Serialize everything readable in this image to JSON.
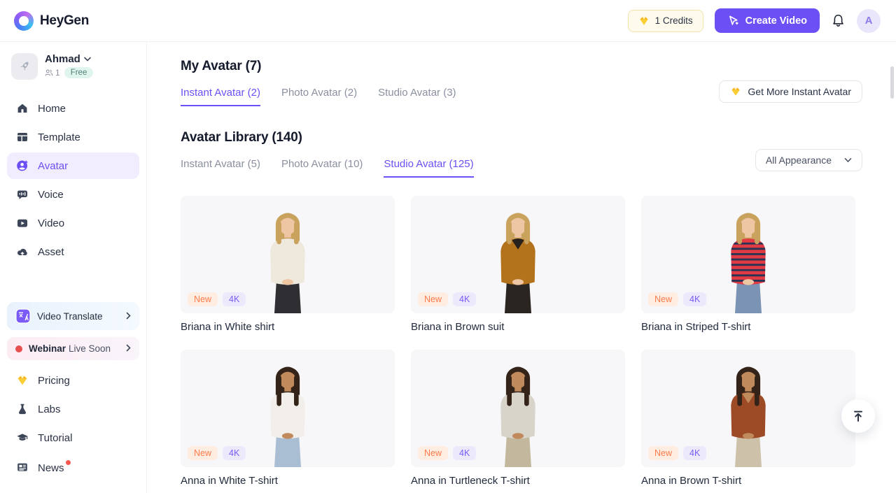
{
  "topbar": {
    "brand": "HeyGen",
    "credits_label": "1 Credits",
    "create_video_label": "Create Video",
    "profile_initial": "A"
  },
  "sidebar": {
    "workspace": {
      "name": "Ahmad",
      "member_count": "1",
      "plan_badge": "Free"
    },
    "items": [
      {
        "label": "Home"
      },
      {
        "label": "Template"
      },
      {
        "label": "Avatar",
        "active": true
      },
      {
        "label": "Voice"
      },
      {
        "label": "Video"
      },
      {
        "label": "Asset"
      }
    ],
    "promos": {
      "video_translate": {
        "label": "Video Translate"
      },
      "webinar": {
        "label_bold": "Webinar",
        "label_rest": "Live Soon"
      }
    },
    "footer_items": [
      {
        "label": "Pricing"
      },
      {
        "label": "Labs"
      },
      {
        "label": "Tutorial"
      },
      {
        "label": "News",
        "has_notification": true
      }
    ]
  },
  "main": {
    "my_avatar": {
      "title": "My Avatar (7)",
      "tabs": [
        {
          "label": "Instant Avatar (2)",
          "active": true
        },
        {
          "label": "Photo Avatar (2)",
          "active": false
        },
        {
          "label": "Studio Avatar (3)",
          "active": false
        }
      ],
      "get_more_label": "Get More Instant Avatar"
    },
    "library": {
      "title": "Avatar Library (140)",
      "tabs": [
        {
          "label": "Instant Avatar (5)",
          "active": false
        },
        {
          "label": "Photo Avatar (10)",
          "active": false
        },
        {
          "label": "Studio Avatar (125)",
          "active": true
        }
      ],
      "filter_label": "All Appearance"
    },
    "cards": [
      {
        "name": "Briana in White shirt",
        "badges": {
          "new": "New",
          "res": "4K"
        },
        "figure": {
          "hair": "#c9a25e",
          "skin": "#efc6a3",
          "top": "#efe9dd",
          "bottom": "#2e2e33",
          "hair_len": 56,
          "strand_len": 34
        }
      },
      {
        "name": "Briana in Brown suit",
        "badges": {
          "new": "New",
          "res": "4K"
        },
        "figure": {
          "hair": "#c9a25e",
          "skin": "#efc6a3",
          "top": "#b3731d",
          "bottom": "#2b2522",
          "under": "#26211d",
          "hair_len": 56,
          "strand_len": 34
        }
      },
      {
        "name": "Briana in Striped T-shirt",
        "badges": {
          "new": "New",
          "res": "4K"
        },
        "figure": {
          "hair": "#c9a25e",
          "skin": "#efc6a3",
          "top": "#e03a44",
          "stripe": "#2a3353",
          "bottom": "#7b93b5",
          "hair_len": 56,
          "strand_len": 34
        }
      },
      {
        "name": "Anna in White T-shirt",
        "badges": {
          "new": "New",
          "res": "4K"
        },
        "figure": {
          "hair": "#342318",
          "skin": "#c08a5c",
          "top": "#f2efea",
          "bottom": "#a9bdd3",
          "hair_len": 76,
          "strand_len": 46
        }
      },
      {
        "name": "Anna in Turtleneck T-shirt",
        "badges": {
          "new": "New",
          "res": "4K"
        },
        "figure": {
          "hair": "#342318",
          "skin": "#c08a5c",
          "top": "#d9d4ca",
          "bottom": "#c3b79e",
          "hair_len": 76,
          "strand_len": 46
        }
      },
      {
        "name": "Anna in Brown T-shirt",
        "badges": {
          "new": "New",
          "res": "4K"
        },
        "figure": {
          "hair": "#342318",
          "skin": "#c08a5c",
          "top": "#9d4a26",
          "under": "#c08a5c",
          "bottom": "#cdc1aa",
          "hair_len": 76,
          "strand_len": 46
        }
      }
    ]
  },
  "colors": {
    "accent_purple": "#6d4ff6",
    "badge_new_bg": "#ffede2",
    "badge_new_text": "#ff7a4a",
    "badge_res_bg": "#ede9fd",
    "badge_res_text": "#7a5bf5",
    "plan_badge_bg": "#dff5ee",
    "plan_badge_text": "#518078",
    "credits_bg": "#fefaec",
    "credits_border": "#f3e3ae",
    "notification_red": "#f5564e",
    "card_bg": "#f7f7f9"
  }
}
